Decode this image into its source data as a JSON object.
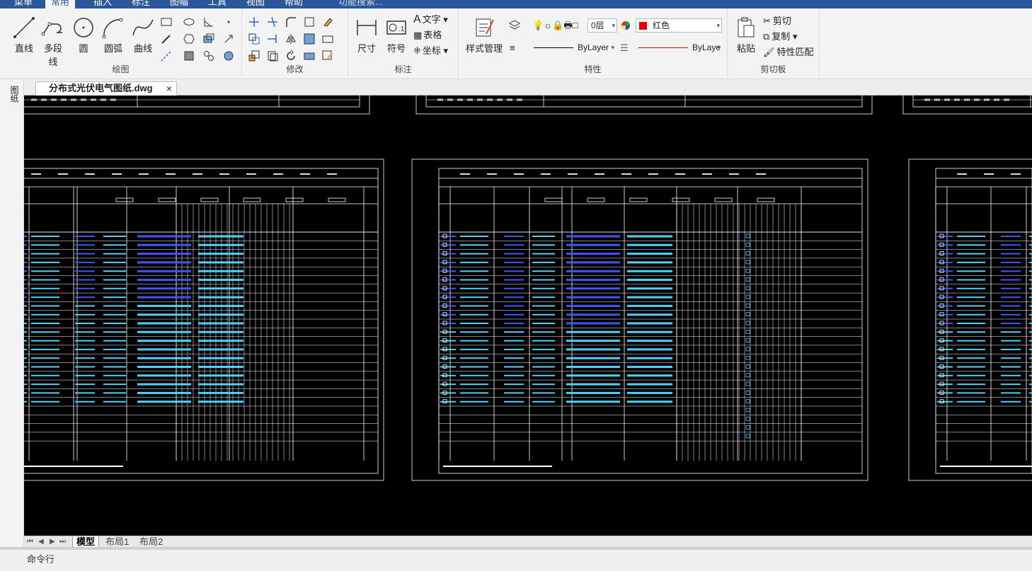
{
  "menu": [
    "菜单",
    "常用",
    "插入",
    "标注",
    "图幅",
    "工具",
    "视图",
    "帮助",
    "功能搜索..."
  ],
  "ribbon": {
    "draw": {
      "label": "绘图",
      "line": "直线",
      "polyline": "多段线",
      "circle": "圆",
      "arc": "圆弧",
      "curve": "曲线"
    },
    "modify": {
      "label": "修改"
    },
    "annotate": {
      "label": "标注",
      "dimension": "尺寸",
      "symbol": "符号",
      "text": "文字",
      "table": "表格",
      "coord": "坐标"
    },
    "properties": {
      "label": "特性",
      "style_manager": "样式管理",
      "layer": "0层",
      "color": "红色",
      "linetype": "ByLayer",
      "lineweight": "ByLaye"
    },
    "clipboard": {
      "label": "剪切板",
      "paste": "粘贴",
      "cut": "剪切",
      "copy": "复制",
      "match": "特性匹配"
    }
  },
  "left_strip": {
    "label": "图纸"
  },
  "document_tab": {
    "title": "分布式光伏电气图纸.dwg",
    "close": "×"
  },
  "layout_tabs": [
    "模型",
    "布局1",
    "布局2"
  ],
  "command_line": {
    "label": "命令行"
  },
  "colors": {
    "accent": "#2b579a",
    "canvas": "#000000",
    "layer_color": "#e00000"
  }
}
